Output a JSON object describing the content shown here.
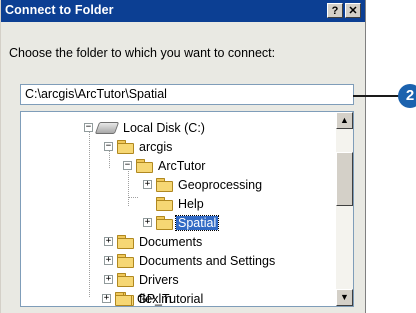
{
  "window": {
    "title": "Connect to Folder",
    "help_label": "?",
    "close_label": "✕"
  },
  "prompt": "Choose the folder to which you want to connect:",
  "path_value": "C:\\arcgis\\ArcTutor\\Spatial",
  "tree": {
    "items": [
      {
        "label": "Local Disk (C:)",
        "icon": "drive-icon",
        "expander": "minus"
      },
      {
        "label": "arcgis",
        "icon": "folder-icon",
        "expander": "minus"
      },
      {
        "label": "ArcTutor",
        "icon": "folder-open-icon",
        "expander": "minus"
      },
      {
        "label": "Geoprocessing",
        "icon": "folder-icon",
        "expander": "plus"
      },
      {
        "label": "Help",
        "icon": "folder-icon",
        "expander": "none"
      },
      {
        "label": "Spatial",
        "icon": "folder-open-icon",
        "expander": "plus",
        "selected": true
      },
      {
        "label": "Documents",
        "icon": "folder-icon",
        "expander": "plus"
      },
      {
        "label": "Documents and Settings",
        "icon": "folder-icon",
        "expander": "plus"
      },
      {
        "label": "Drivers",
        "icon": "folder-icon",
        "expander": "plus"
      },
      {
        "label": "flexlm",
        "icon": "folder-icon",
        "expander": "none"
      },
      {
        "label": "GP_Tutorial",
        "icon": "folder-icon",
        "expander": "plus"
      }
    ]
  },
  "scroll": {
    "up_icon": "▲",
    "down_icon": "▼"
  },
  "callout": {
    "number": "2",
    "color": "#1b62ae"
  },
  "colors": {
    "titlebar": "#0c3f93",
    "selection": "#316ac5"
  }
}
